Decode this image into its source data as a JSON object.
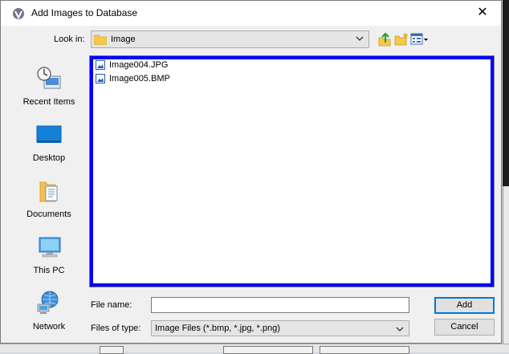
{
  "dialog": {
    "title": "Add Images to Database",
    "close_glyph": "✕",
    "app_icon": "app-icon"
  },
  "lookin": {
    "label": "Look in:",
    "value": "Image",
    "icons": [
      "folder-icon",
      "chevron-down-icon",
      "up-one-level-icon",
      "new-folder-icon",
      "view-menu-icon"
    ]
  },
  "places": [
    {
      "label": "Recent Items",
      "icon": "recent-items-icon"
    },
    {
      "label": "Desktop",
      "icon": "desktop-icon"
    },
    {
      "label": "Documents",
      "icon": "documents-icon"
    },
    {
      "label": "This PC",
      "icon": "computer-icon"
    },
    {
      "label": "Network",
      "icon": "network-icon"
    }
  ],
  "files": [
    {
      "name": "Image004.JPG",
      "icon": "image-file-icon"
    },
    {
      "name": "Image005.BMP",
      "icon": "image-file-icon"
    }
  ],
  "filename": {
    "label": "File name:",
    "value": ""
  },
  "filetype": {
    "label": "Files of type:",
    "value": "Image Files (*.bmp, *.jpg, *.png)"
  },
  "buttons": {
    "add": "Add",
    "cancel": "Cancel"
  },
  "colors": {
    "selection_border": "#0000ff",
    "default_button_border": "#0078d7",
    "dialog_background": "#f0f0f0"
  }
}
